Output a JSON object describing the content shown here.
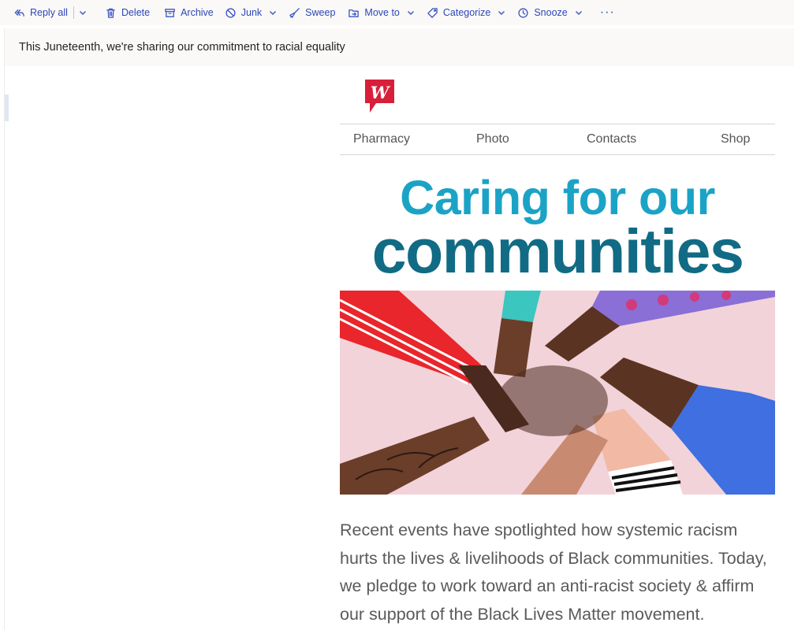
{
  "toolbar": {
    "reply_all": "Reply all",
    "delete": "Delete",
    "archive": "Archive",
    "junk": "Junk",
    "sweep": "Sweep",
    "move_to": "Move to",
    "categorize": "Categorize",
    "snooze": "Snooze",
    "more": "···"
  },
  "message": {
    "subject": "This Juneteenth, we're sharing our commitment to racial equality"
  },
  "email": {
    "logo_letter": "W",
    "nav": [
      "Pharmacy",
      "Photo",
      "Contacts",
      "Shop"
    ],
    "headline_line1": "Caring for our",
    "headline_line2": "communities",
    "body": "Recent events have spotlighted how systemic racism hurts the lives & livelihoods of Black communities. Today, we pledge to work toward an anti-racist society & affirm our support of the Black Lives Matter movement."
  },
  "colors": {
    "toolbar_text": "#2b47b8",
    "brand_red": "#d71f3a",
    "headline_light": "#1ba3c6",
    "headline_dark": "#116b85",
    "hero_bg": "#f2d3da"
  },
  "icons": {
    "reply_all": "reply-all-icon",
    "delete": "trash-icon",
    "archive": "archive-icon",
    "junk": "block-icon",
    "sweep": "broom-icon",
    "move_to": "folder-move-icon",
    "categorize": "tag-icon",
    "snooze": "clock-icon"
  }
}
